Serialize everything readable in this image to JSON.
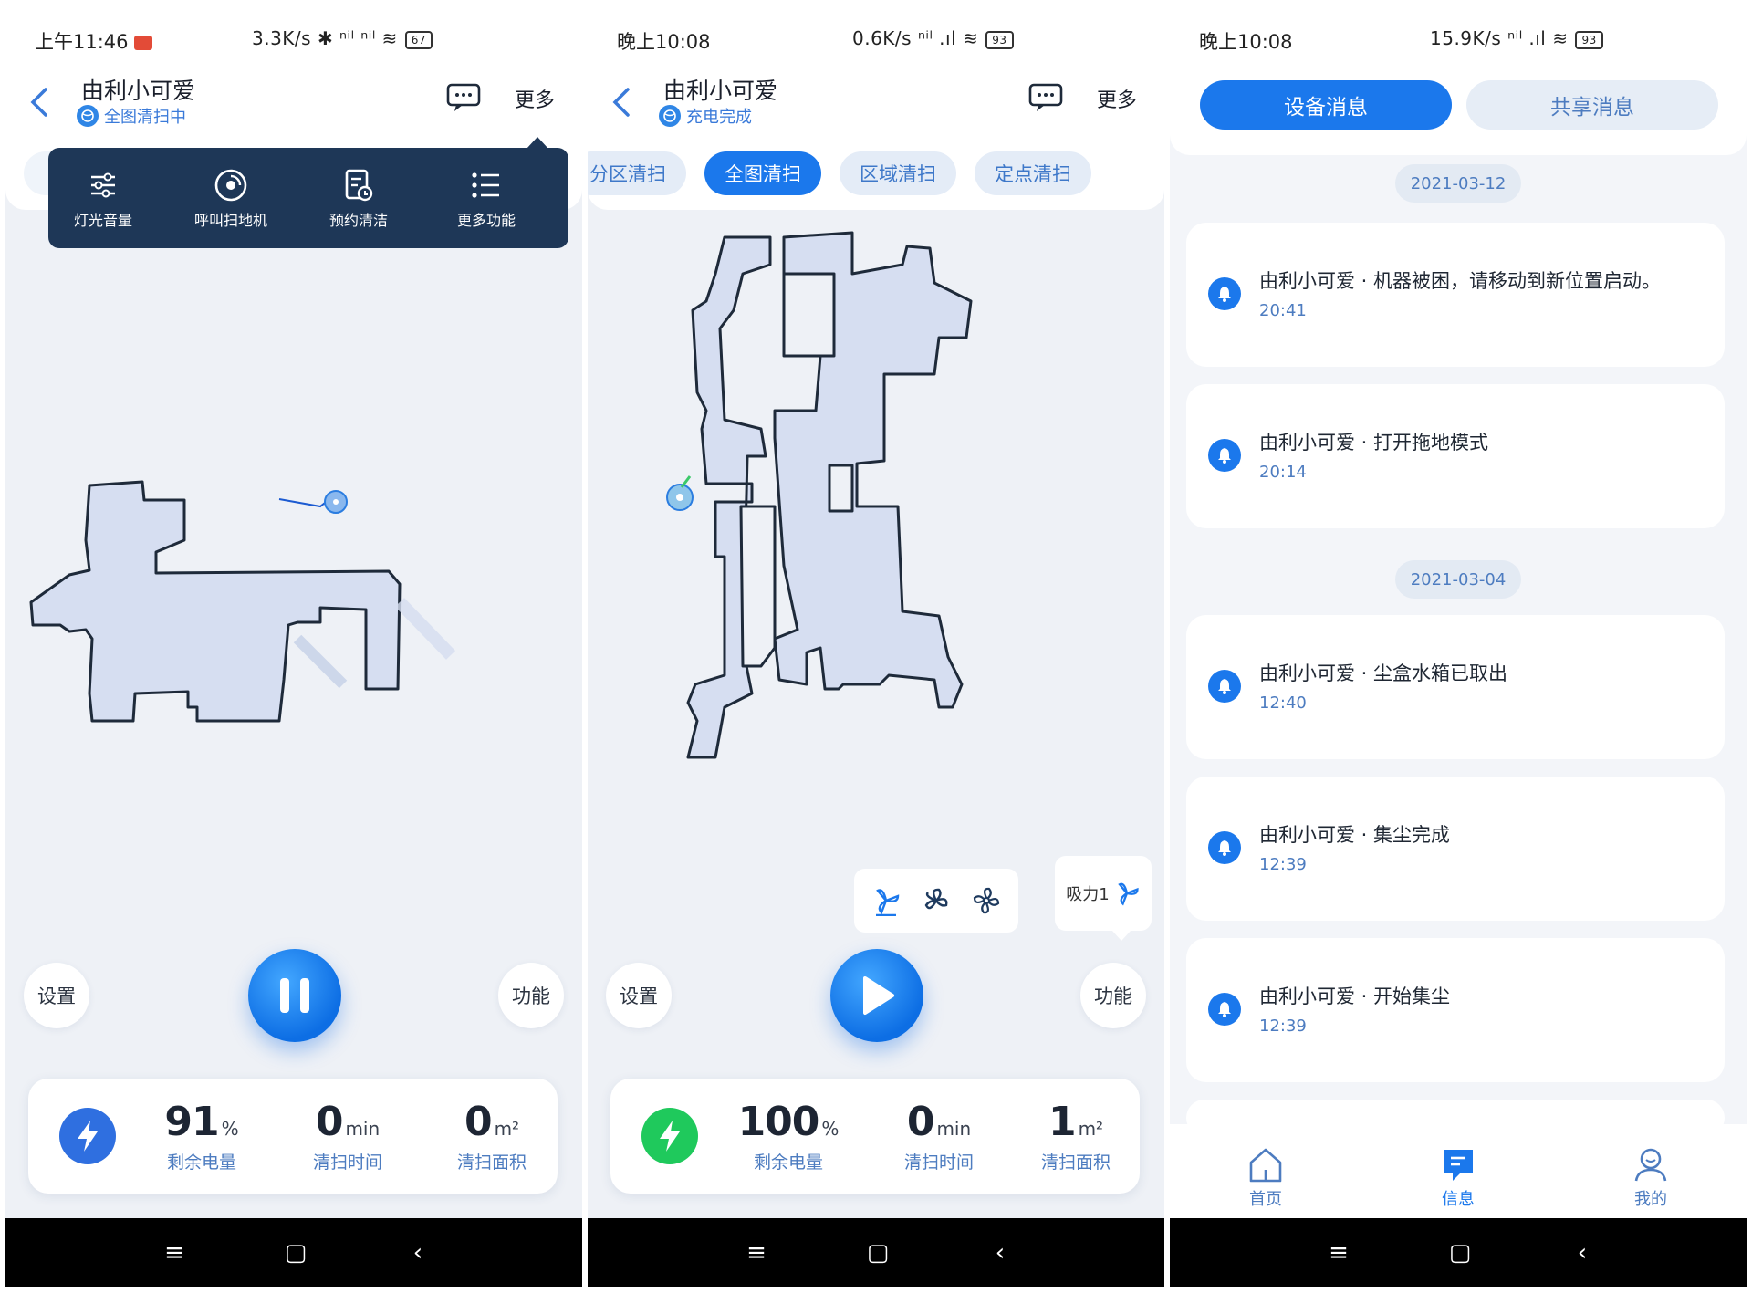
{
  "screens": [
    {
      "status": {
        "time": "上午11:46",
        "network": "3.3K/s ✱ ⁿⁱˡ ⁿⁱˡ ≋",
        "battery": "67"
      },
      "device": {
        "name": "由利小可爱",
        "status": "全图清扫中"
      },
      "header": {
        "more_label": "更多"
      },
      "more_menu": [
        {
          "label": "灯光音量",
          "icon": "sliders-icon"
        },
        {
          "label": "呼叫扫地机",
          "icon": "call-robot-icon"
        },
        {
          "label": "预约清洁",
          "icon": "schedule-icon"
        },
        {
          "label": "更多功能",
          "icon": "list-icon"
        }
      ],
      "controls": {
        "settings_label": "设置",
        "function_label": "功能",
        "main_action": "pause"
      },
      "stats": {
        "battery": {
          "value": "91",
          "unit": "%",
          "label": "剩余电量"
        },
        "clean_time": {
          "value": "0",
          "unit": "min",
          "label": "清扫时间"
        },
        "clean_area": {
          "value": "0",
          "unit": "m²",
          "label": "清扫面积"
        }
      },
      "battery_color": "#2f6fe0"
    },
    {
      "status": {
        "time": "晚上10:08",
        "network": "0.6K/s ⁿⁱˡ .ıl ≋",
        "battery": "93"
      },
      "device": {
        "name": "由利小可爱",
        "status": "充电完成"
      },
      "header": {
        "more_label": "更多"
      },
      "modes": [
        {
          "label": "分区清扫",
          "active": false
        },
        {
          "label": "全图清扫",
          "active": true
        },
        {
          "label": "区域清扫",
          "active": false
        },
        {
          "label": "定点清扫",
          "active": false
        }
      ],
      "suction": {
        "label": "吸力1",
        "levels": [
          "fan-level-1-icon",
          "fan-level-2-icon",
          "fan-level-3-icon"
        ],
        "selected": 1
      },
      "controls": {
        "settings_label": "设置",
        "function_label": "功能",
        "main_action": "play"
      },
      "stats": {
        "battery": {
          "value": "100",
          "unit": "%",
          "label": "剩余电量"
        },
        "clean_time": {
          "value": "0",
          "unit": "min",
          "label": "清扫时间"
        },
        "clean_area": {
          "value": "1",
          "unit": "m²",
          "label": "清扫面积"
        }
      },
      "battery_color": "#1fc95c"
    },
    {
      "status": {
        "time": "晚上10:08",
        "network": "15.9K/s ⁿⁱˡ .ıl ≋",
        "battery": "93"
      },
      "tabs": {
        "device_messages": "设备消息",
        "share_messages": "共享消息"
      },
      "groups": [
        {
          "date": "2021-03-12",
          "messages": [
            {
              "text": "由利小可爱 · 机器被困，请移动到新位置启动。",
              "time": "20:41"
            },
            {
              "text": "由利小可爱 · 打开拖地模式",
              "time": "20:14"
            }
          ]
        },
        {
          "date": "2021-03-04",
          "messages": [
            {
              "text": "由利小可爱 · 尘盒水箱已取出",
              "time": "12:40"
            },
            {
              "text": "由利小可爱 · 集尘完成",
              "time": "12:39"
            },
            {
              "text": "由利小可爱 · 开始集尘",
              "time": "12:39"
            }
          ]
        }
      ],
      "bottom_nav": [
        {
          "label": "首页",
          "icon": "home-icon",
          "active": false
        },
        {
          "label": "信息",
          "icon": "message-icon",
          "active": true
        },
        {
          "label": "我的",
          "icon": "profile-icon",
          "active": false
        }
      ]
    }
  ],
  "system_nav": {
    "menu": "≡",
    "home": "▢",
    "back": "‹"
  }
}
